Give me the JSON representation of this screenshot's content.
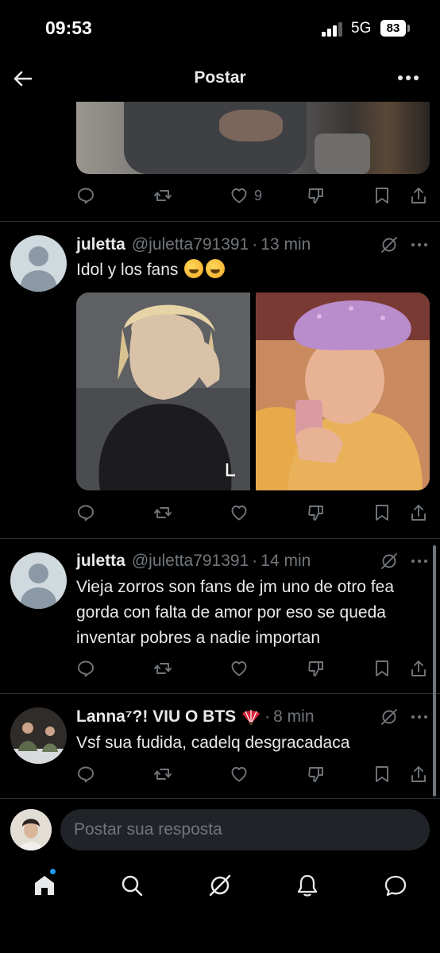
{
  "status_bar": {
    "time": "09:53",
    "network": "5G",
    "battery": "83"
  },
  "header": {
    "title": "Postar"
  },
  "post_actions": {
    "likes": "9"
  },
  "tweets": [
    {
      "name": "juletta",
      "handle": "@juletta791391",
      "time": "13 min",
      "text": "Idol y los fans"
    },
    {
      "name": "juletta",
      "handle": "@juletta791391",
      "time": "14 min",
      "text": "Vieja zorros son fans de jm uno de otro fea gorda con falta de amor por eso se queda inventar pobres a nadie importan"
    },
    {
      "name": "Lanna⁷?! VIU O BTS",
      "time": "8 min",
      "text": "Vsf sua fudida, cadelq desgracadaca"
    }
  ],
  "reply": {
    "placeholder": "Postar sua resposta"
  },
  "tabs": [
    "home-icon",
    "search-icon",
    "grok-icon",
    "notifications-icon",
    "messages-icon"
  ],
  "colors": {
    "background": "#000000",
    "text": "#e7e9ea",
    "muted": "#71767b",
    "accent": "#1d9bf0"
  }
}
